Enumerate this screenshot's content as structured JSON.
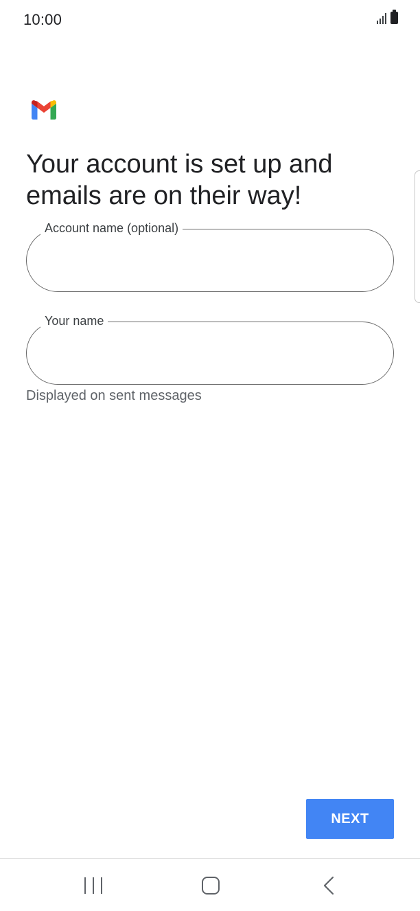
{
  "status_bar": {
    "time": "10:00",
    "icons": [
      "signal-icon",
      "battery-icon"
    ]
  },
  "logo": {
    "name": "gmail-logo",
    "colors": [
      "#4285f4",
      "#ea4335",
      "#fbbc04",
      "#34a853",
      "#c5221f"
    ]
  },
  "heading": "Your account is set up and emails are on their way!",
  "fields": [
    {
      "label": "Account name (optional)",
      "value": "",
      "placeholder": ""
    },
    {
      "label": "Your name",
      "value": "",
      "placeholder": ""
    }
  ],
  "helper_text": "Displayed on sent messages",
  "next_button": {
    "label": "NEXT",
    "color": "#4285f4"
  },
  "nav_bar": {
    "icons": [
      "recents-icon",
      "home-icon",
      "back-icon"
    ]
  }
}
